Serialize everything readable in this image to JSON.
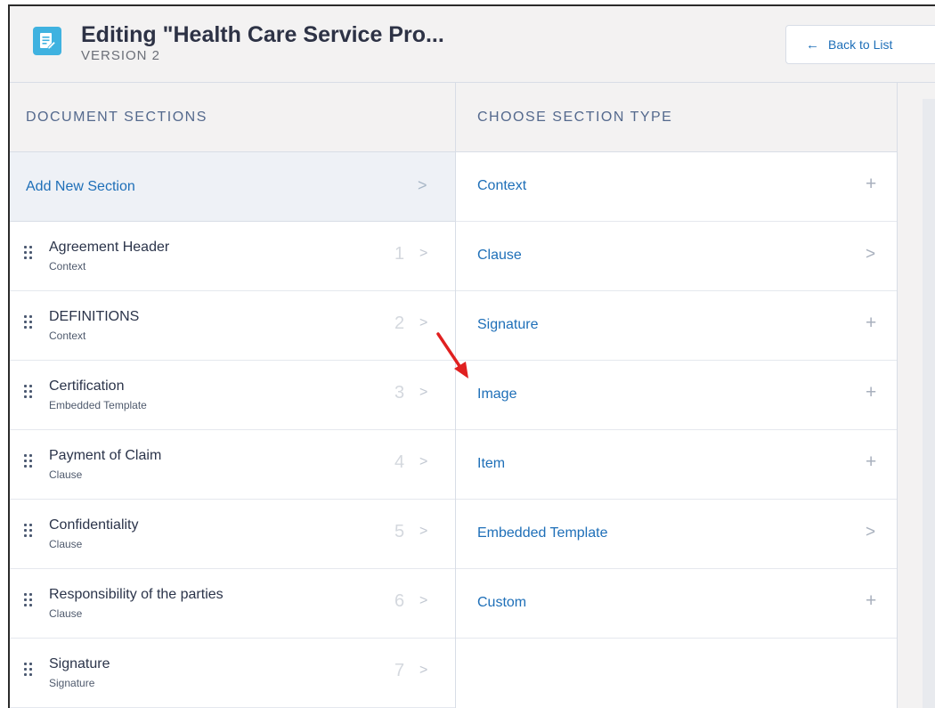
{
  "header": {
    "title": "Editing \"Health Care Service Pro...",
    "subtitle": "VERSION 2",
    "back_label": "Back to List",
    "back_arrow": "←"
  },
  "document_sections": {
    "heading": "DOCUMENT SECTIONS",
    "add_label": "Add New Section",
    "chevron": ">",
    "items": [
      {
        "name": "Agreement Header",
        "type": "Context",
        "number": "1"
      },
      {
        "name": "DEFINITIONS",
        "type": "Context",
        "number": "2"
      },
      {
        "name": "Certification",
        "type": "Embedded Template",
        "number": "3"
      },
      {
        "name": "Payment of Claim",
        "type": "Clause",
        "number": "4"
      },
      {
        "name": "Confidentiality",
        "type": "Clause",
        "number": "5"
      },
      {
        "name": "Responsibility of the parties",
        "type": "Clause",
        "number": "6"
      },
      {
        "name": "Signature",
        "type": "Signature",
        "number": "7"
      }
    ]
  },
  "section_types": {
    "heading": "CHOOSE SECTION TYPE",
    "items": [
      {
        "label": "Context",
        "action": "+",
        "action_icon": "plus-icon"
      },
      {
        "label": "Clause",
        "action": ">",
        "action_icon": "chevron-right-icon"
      },
      {
        "label": "Signature",
        "action": "+",
        "action_icon": "plus-icon"
      },
      {
        "label": "Image",
        "action": "+",
        "action_icon": "plus-icon"
      },
      {
        "label": "Item",
        "action": "+",
        "action_icon": "plus-icon"
      },
      {
        "label": "Embedded Template",
        "action": ">",
        "action_icon": "chevron-right-icon"
      },
      {
        "label": "Custom",
        "action": "+",
        "action_icon": "plus-icon"
      }
    ]
  },
  "colors": {
    "accent": "#1e6fb8",
    "app_icon": "#3fb2e0",
    "annotation_arrow": "#e02020"
  }
}
